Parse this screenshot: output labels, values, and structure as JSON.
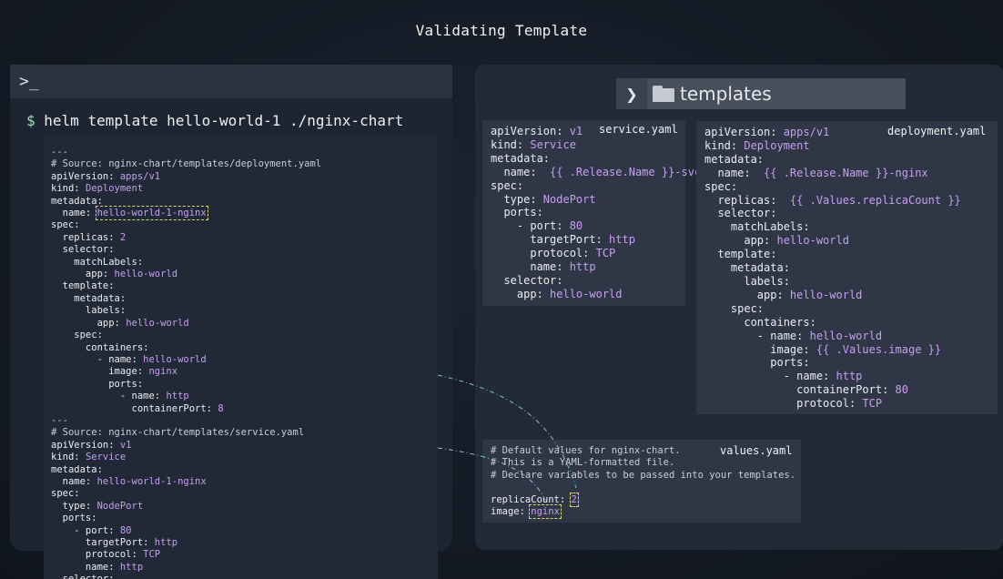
{
  "title": "Validating Template",
  "terminal": {
    "prompt_icon": ">_",
    "dollar": "$",
    "command": "helm template hello-world-1 ./nginx-chart"
  },
  "output": {
    "sep1": "---",
    "src1": "# Source: nginx-chart/templates/deployment.yaml",
    "api1": "apps/v1",
    "kind1": "Deployment",
    "name1": "hello-world-1-nginx",
    "replicas": "2",
    "app_label": "hello-world",
    "meta_app": "hello-world",
    "container_name": "hello-world",
    "image": "nginx",
    "port_name": "http",
    "container_port": "8",
    "sep2": "---",
    "src2": "# Source: nginx-chart/templates/service.yaml",
    "api2": "v1",
    "kind2": "Service",
    "name2": "hello-world-1-nginx",
    "type2": "NodePort",
    "port2": "80",
    "target2": "http",
    "proto2": "TCP",
    "pname2": "http"
  },
  "folder": {
    "name": "templates"
  },
  "service_yaml": {
    "filename": "service.yaml",
    "api": "v1",
    "kind": "Service",
    "name": "{{ .Release.Name }}-svc",
    "type": "NodePort",
    "port": "80",
    "target": "http",
    "proto": "TCP",
    "pname": "http",
    "app": "hello-world"
  },
  "deployment_yaml": {
    "filename": "deployment.yaml",
    "api": "apps/v1",
    "kind": "Deployment",
    "name": "{{ .Release.Name }}-nginx",
    "replicas": "{{ .Values.replicaCount }}",
    "match_app": "hello-world",
    "meta_app": "hello-world",
    "container": "hello-world",
    "image": "{{ .Values.image }}",
    "pname": "http",
    "cport": "80",
    "proto": "TCP"
  },
  "values_yaml": {
    "filename": "values.yaml",
    "c1": "# Default values for nginx-chart.",
    "c2": "# This is a YAML-formatted file.",
    "c3": "# Declare variables to be passed into your templates.",
    "replica_count": "2",
    "image": "nginx"
  },
  "colors": {
    "value": "#c79ff0",
    "prompt": "#9fe0b7",
    "highlight": "#d8d86a",
    "connector": "#7fc4c8"
  }
}
